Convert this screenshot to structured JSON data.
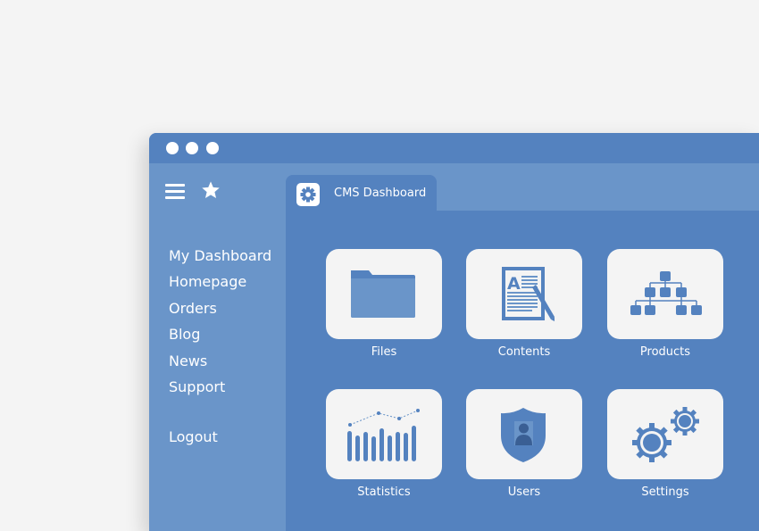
{
  "window": {
    "controls": [
      "dot",
      "dot",
      "dot"
    ]
  },
  "toolbar": {
    "menu_icon": "hamburger-menu-icon",
    "favorite_icon": "star-icon"
  },
  "sidebar": {
    "items": [
      {
        "label": "My Dashboard"
      },
      {
        "label": "Homepage"
      },
      {
        "label": "Orders"
      },
      {
        "label": "Blog"
      },
      {
        "label": "News"
      },
      {
        "label": "Support"
      }
    ],
    "logout_label": "Logout"
  },
  "tab": {
    "label": "CMS Dashboard",
    "icon": "gear-icon"
  },
  "tiles": [
    {
      "label": "Files",
      "icon": "folder-icon"
    },
    {
      "label": "Contents",
      "icon": "document-edit-icon"
    },
    {
      "label": "Products",
      "icon": "hierarchy-icon"
    },
    {
      "label": "Statistics",
      "icon": "bar-chart-icon"
    },
    {
      "label": "Users",
      "icon": "user-shield-icon"
    },
    {
      "label": "Settings",
      "icon": "gears-icon"
    }
  ],
  "colors": {
    "background": "#f4f4f4",
    "titlebar": "#5482bf",
    "sidebar": "#6a95c9",
    "main": "#5482bf",
    "tile": "#f4f4f4",
    "icon_primary": "#5482bf",
    "icon_light": "#6a95c9"
  }
}
